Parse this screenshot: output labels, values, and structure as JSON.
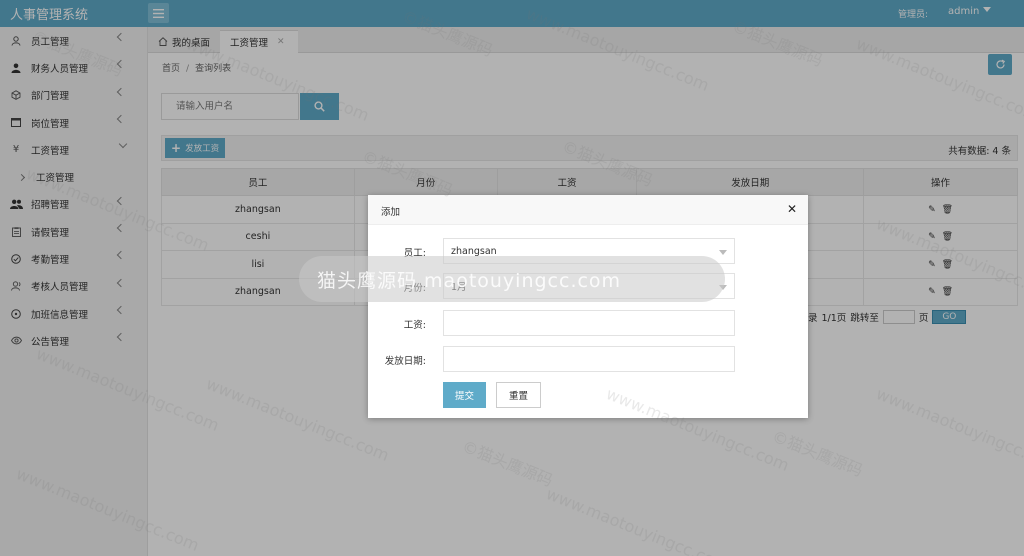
{
  "header": {
    "app_title": "人事管理系统",
    "admin_label": "管理员:",
    "admin_user": "admin"
  },
  "sidebar": {
    "items": [
      {
        "label": "员工管理",
        "icon": "user-icon"
      },
      {
        "label": "财务人员管理",
        "icon": "person-icon"
      },
      {
        "label": "部门管理",
        "icon": "cube-icon"
      },
      {
        "label": "岗位管理",
        "icon": "window-icon"
      },
      {
        "label": "工资管理",
        "icon": "yen-icon",
        "expanded": true
      },
      {
        "label": "工资管理",
        "icon": "sub-arrow-icon",
        "sub": true
      },
      {
        "label": "招聘管理",
        "icon": "users-icon"
      },
      {
        "label": "请假管理",
        "icon": "clipboard-icon"
      },
      {
        "label": "考勤管理",
        "icon": "check-circle-icon"
      },
      {
        "label": "考核人员管理",
        "icon": "user-group-icon"
      },
      {
        "label": "加班信息管理",
        "icon": "plus-circle-icon"
      },
      {
        "label": "公告管理",
        "icon": "eye-icon"
      }
    ]
  },
  "tabs": {
    "home_label": "我的桌面",
    "active_label": "工资管理",
    "close_glyph": "✕"
  },
  "breadcrumb": {
    "home": "首页",
    "sep": "/",
    "current": "查询列表"
  },
  "search": {
    "placeholder": "请输入用户名",
    "value": ""
  },
  "toolbar": {
    "add_label": "发放工资",
    "total_text": "共有数据: 4 条"
  },
  "table": {
    "columns": [
      "员工",
      "月份",
      "工资",
      "发放日期",
      "操作"
    ],
    "rows": [
      {
        "employee": "zhangsan"
      },
      {
        "employee": "ceshi"
      },
      {
        "employee": "lisi"
      },
      {
        "employee": "zhangsan"
      }
    ]
  },
  "pager": {
    "text_prefix": "录",
    "pages": "1/1页",
    "jump_label": "跳转至",
    "jump_value": "",
    "page_suffix": "页",
    "go_label": "GO"
  },
  "modal": {
    "title": "添加",
    "close_glyph": "✕",
    "employee_label": "员工:",
    "employee_value": "zhangsan",
    "month_label": "月份:",
    "month_value": "1月",
    "salary_label": "工资:",
    "salary_value": "",
    "date_label": "发放日期:",
    "date_value": "",
    "submit_label": "提交",
    "reset_label": "重置"
  },
  "watermark": {
    "banner_text": "猫头鹰源码 maotouyingcc.com",
    "tile_text": "©猫头鹰源码",
    "tile_url": "www.maotouyingcc.com"
  },
  "colors": {
    "accent": "#5fabc9",
    "sidebar_bg": "#f3f3f3",
    "overlay": "rgba(0,0,0,0.30)"
  }
}
